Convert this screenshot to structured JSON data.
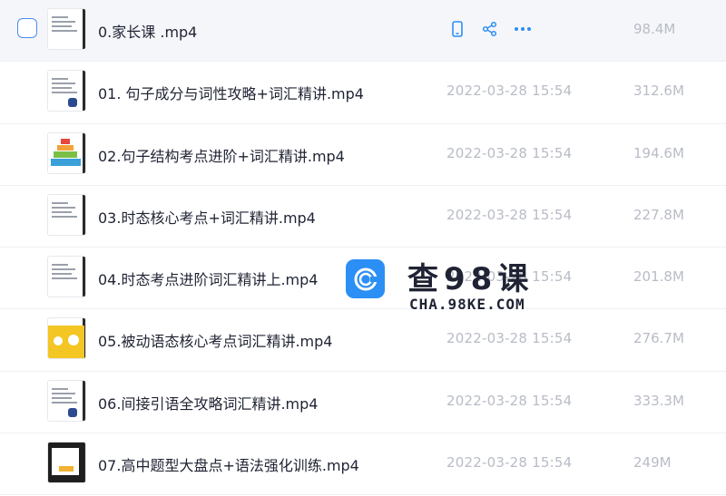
{
  "files": [
    {
      "name": "0.家长课 .mp4",
      "date": "",
      "size": "98.4M",
      "selected_row": true,
      "thumb": "doc"
    },
    {
      "name": "01. 句子成分与词性攻略+词汇精讲.mp4",
      "date": "2022-03-28 15:54",
      "size": "312.6M",
      "thumb": "doc-figure"
    },
    {
      "name": "02.句子结构考点进阶+词汇精讲.mp4",
      "date": "2022-03-28 15:54",
      "size": "194.6M",
      "thumb": "pyramid"
    },
    {
      "name": "03.时态核心考点+词汇精讲.mp4",
      "date": "2022-03-28 15:54",
      "size": "227.8M",
      "thumb": "doc"
    },
    {
      "name": "04.时态考点进阶词汇精讲上.mp4",
      "date": "2022-03-28 15:54",
      "size": "201.8M",
      "thumb": "doc"
    },
    {
      "name": "05.被动语态核心考点词汇精讲.mp4",
      "date": "2022-03-28 15:54",
      "size": "276.7M",
      "thumb": "yellow"
    },
    {
      "name": "06.间接引语全攻略词汇精讲.mp4",
      "date": "2022-03-28 15:54",
      "size": "333.3M",
      "thumb": "doc-figure"
    },
    {
      "name": "07.高中题型大盘点+语法强化训练.mp4",
      "date": "2022-03-28 15:54",
      "size": "249M",
      "thumb": "dark"
    }
  ],
  "row_actions": {
    "icons": [
      "phone-icon",
      "share-icon",
      "more-icon"
    ],
    "accent": "#2b8ff5"
  },
  "watermark": {
    "title": "查98课",
    "url": "CHA.98KE.COM"
  },
  "colors": {
    "checkbox_border": "#4a8cf7",
    "row_hover": "#f5f6f9",
    "meta_text": "#b8bcc6"
  }
}
